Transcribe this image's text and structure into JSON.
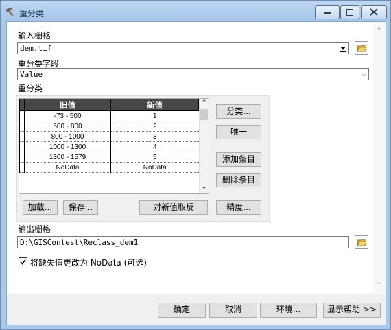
{
  "window": {
    "title": "重分类",
    "min_glyph": "▭",
    "max_glyph": "▢",
    "close_glyph": "✕"
  },
  "input_raster": {
    "label": "输入栅格",
    "value": "dem.tif"
  },
  "reclass_field": {
    "label": "重分类字段",
    "value": "Value"
  },
  "reclassification": {
    "label": "重分类",
    "columns": [
      "旧值",
      "新值"
    ],
    "rows": [
      {
        "old": "-73 - 500",
        "new": "1"
      },
      {
        "old": "500 - 800",
        "new": "2"
      },
      {
        "old": "800 - 1000",
        "new": "3"
      },
      {
        "old": "1000 - 1300",
        "new": "4"
      },
      {
        "old": "1300 - 1579",
        "new": "5"
      },
      {
        "old": "NoData",
        "new": "NoData"
      }
    ],
    "buttons": {
      "classify": "分类...",
      "unique": "唯一",
      "add_entry": "添加条目",
      "delete_entry": "删除条目",
      "load": "加载...",
      "save": "保存...",
      "reverse": "对新值取反",
      "precision": "精度..."
    }
  },
  "output_raster": {
    "label": "输出栅格",
    "value": "D:\\GISContest\\Reclass_dem1"
  },
  "nodata_option": {
    "label": "将缺失值更改为 NoData (可选)",
    "checked": true
  },
  "footer": {
    "ok": "确定",
    "cancel": "取消",
    "environments": "环境...",
    "show_help": "显示帮助 >>"
  },
  "colors": {
    "title_bar": "#a9c8ea",
    "folder_icon": "#e8b83a",
    "table_header": "#474747"
  }
}
